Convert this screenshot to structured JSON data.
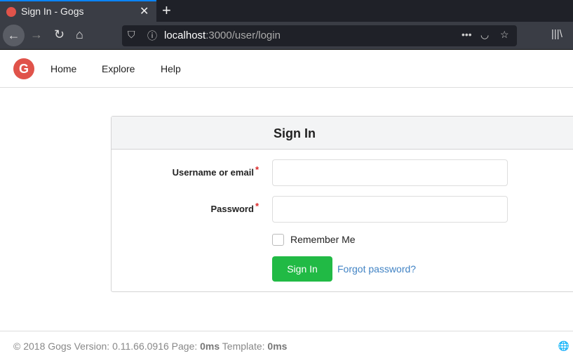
{
  "browser": {
    "tab_title": "Sign In - Gogs",
    "url_host": "localhost",
    "url_rest": ":3000/user/login"
  },
  "nav": {
    "items": [
      {
        "label": "Home"
      },
      {
        "label": "Explore"
      },
      {
        "label": "Help"
      }
    ]
  },
  "form": {
    "title": "Sign In",
    "username_label": "Username or email",
    "password_label": "Password",
    "required_mark": "*",
    "username_value": "",
    "password_value": "",
    "remember_label": "Remember Me",
    "remember_checked": false,
    "submit_label": "Sign In",
    "forgot_label": "Forgot password?"
  },
  "footer": {
    "copyright": "© 2018 Gogs Version: 0.11.66.0916 Page: ",
    "page_time": "0ms",
    "template_label": " Template: ",
    "template_time": "0ms"
  },
  "colors": {
    "accent": "#21ba45",
    "link": "#4183c4",
    "brand": "#e0534a"
  }
}
